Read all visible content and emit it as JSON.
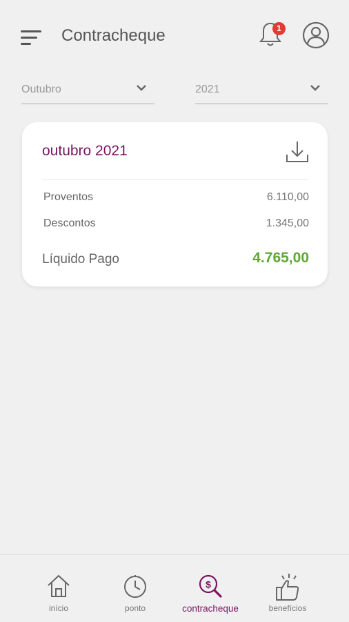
{
  "header": {
    "title": "Contracheque",
    "notification_count": "1"
  },
  "filters": {
    "month": "Outubro",
    "year": "2021"
  },
  "card": {
    "title": "outubro 2021",
    "rows": [
      {
        "label": "Proventos",
        "value": "6.110,00"
      },
      {
        "label": "Descontos",
        "value": "1.345,00"
      }
    ],
    "net_label": "Líquido Pago",
    "net_value": "4.765,00"
  },
  "nav": {
    "items": [
      {
        "label": "início",
        "icon": "home-icon"
      },
      {
        "label": "ponto",
        "icon": "clock-icon"
      },
      {
        "label": "contracheque",
        "icon": "paycheck-search-icon"
      },
      {
        "label": "benefícios",
        "icon": "thumbs-up-icon"
      }
    ],
    "active_index": 2
  },
  "colors": {
    "brand": "#7a1460",
    "positive": "#5fa832",
    "badge": "#e53935",
    "background": "#f0f0f0"
  }
}
